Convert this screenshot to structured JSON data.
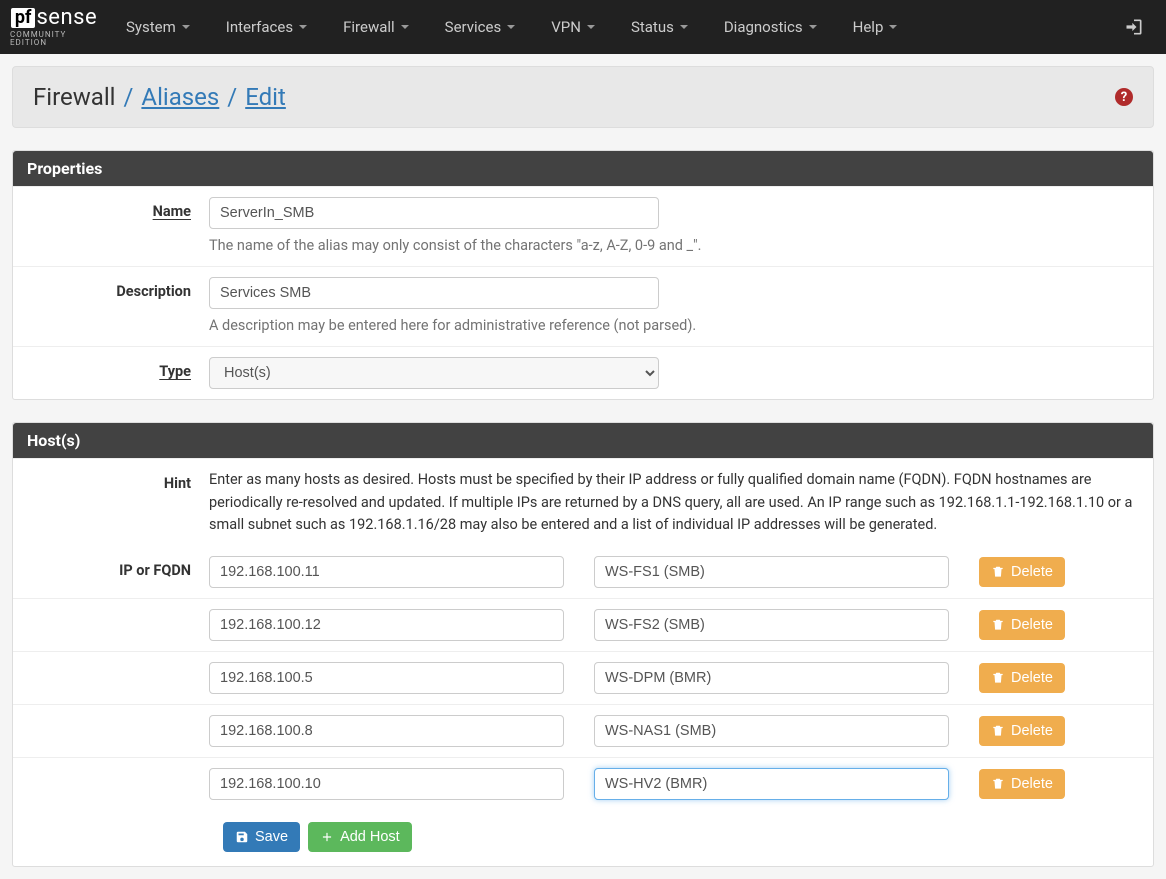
{
  "nav": {
    "items": [
      "System",
      "Interfaces",
      "Firewall",
      "Services",
      "VPN",
      "Status",
      "Diagnostics",
      "Help"
    ]
  },
  "breadcrumbs": {
    "root": "Firewall",
    "l1": "Aliases",
    "l2": "Edit"
  },
  "panels": {
    "properties_title": "Properties",
    "hosts_title": "Host(s)"
  },
  "labels": {
    "name": "Name",
    "description": "Description",
    "type": "Type",
    "hint": "Hint",
    "ip_or_fqdn": "IP or FQDN"
  },
  "help": {
    "name": "The name of the alias may only consist of the characters \"a-z, A-Z, 0-9 and _\".",
    "description": "A description may be entered here for administrative reference (not parsed).",
    "hint": "Enter as many hosts as desired. Hosts must be specified by their IP address or fully qualified domain name (FQDN). FQDN hostnames are periodically re-resolved and updated. If multiple IPs are returned by a DNS query, all are used. An IP range such as 192.168.1.1-192.168.1.10 or a small subnet such as 192.168.1.16/28 may also be entered and a list of individual IP addresses will be generated."
  },
  "values": {
    "name": "ServerIn_SMB",
    "description": "Services SMB",
    "type": "Host(s)"
  },
  "hosts": [
    {
      "addr": "192.168.100.11",
      "desc": "WS-FS1 (SMB)"
    },
    {
      "addr": "192.168.100.12",
      "desc": "WS-FS2 (SMB)"
    },
    {
      "addr": "192.168.100.5",
      "desc": "WS-DPM (BMR)"
    },
    {
      "addr": "192.168.100.8",
      "desc": "WS-NAS1 (SMB)"
    },
    {
      "addr": "192.168.100.10",
      "desc": "WS-HV2 (BMR)"
    }
  ],
  "buttons": {
    "delete": "Delete",
    "save": "Save",
    "add_host": "Add Host"
  },
  "logo": {
    "pf": "pf",
    "sense": "sense",
    "sub": "COMMUNITY EDITION"
  }
}
